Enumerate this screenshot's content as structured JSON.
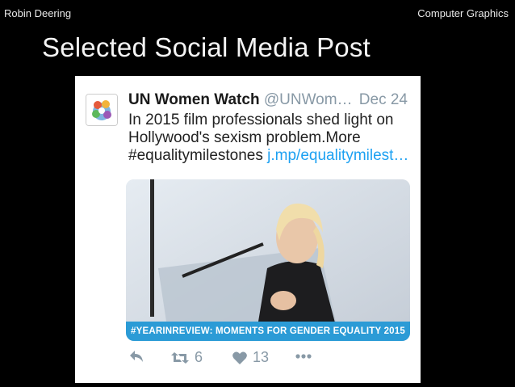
{
  "header": {
    "author": "Robin Deering",
    "course": "Computer Graphics"
  },
  "slide": {
    "title": "Selected Social Media Post"
  },
  "tweet": {
    "author_name": "UN Women Watch",
    "handle": "@UNWom…",
    "date": "Dec 24",
    "text_line1": "In 2015 film professionals shed light on",
    "text_line2": "Hollywood's sexism problem.More",
    "hashtag": "#equalitymilestones",
    "link": "j.mp/equalitymilest…",
    "media_caption": "#YEARINREVIEW: MOMENTS FOR GENDER EQUALITY 2015",
    "retweet_count": "6",
    "like_count": "13",
    "icons": [
      "reply-icon",
      "retweet-icon",
      "heart-icon",
      "more-icon"
    ]
  },
  "colors": {
    "background": "#000000",
    "link": "#1da1f2",
    "muted": "#8899a6",
    "banner": "#2b9bd6"
  }
}
